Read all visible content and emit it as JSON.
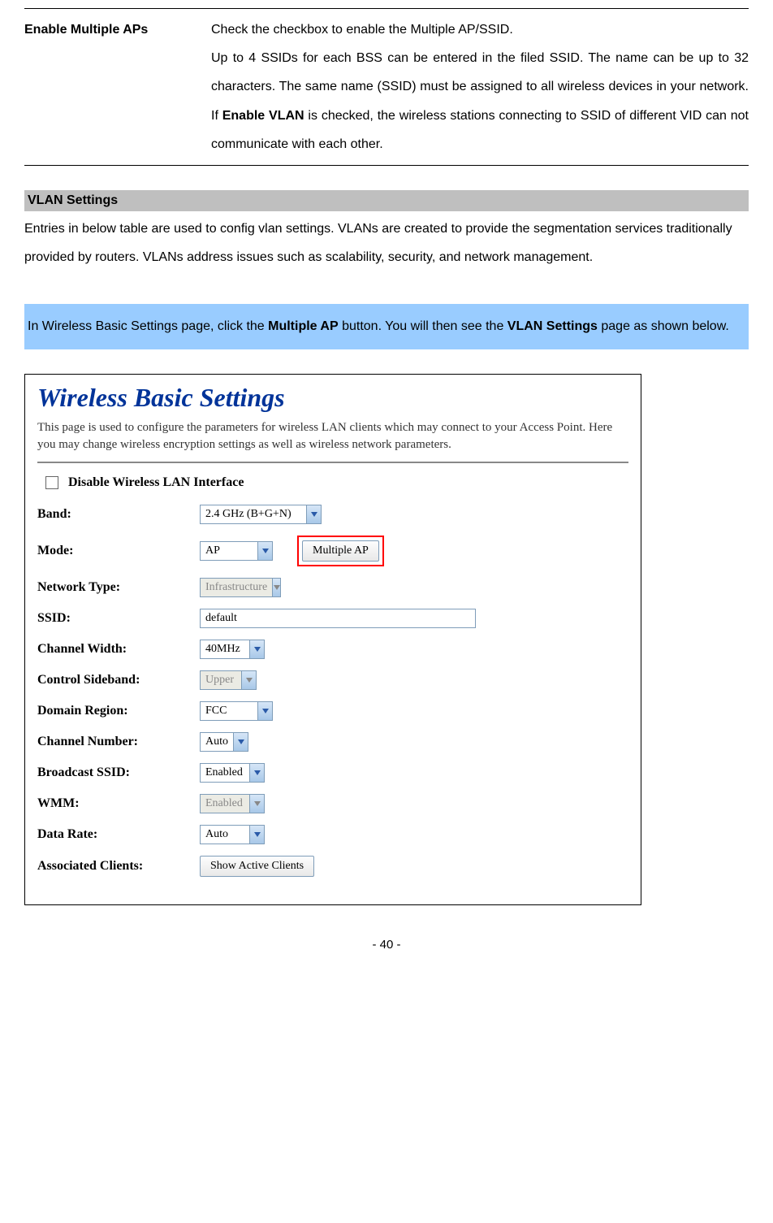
{
  "definition": {
    "term": "Enable Multiple APs",
    "description_parts": {
      "line1": "Check the checkbox to enable the Multiple AP/SSID.",
      "line2_pre": "Up to 4 SSIDs for each BSS can be entered in the filed SSID. The name can be up to 32 characters. The same name (SSID) must be assigned to all wireless devices in your network. If ",
      "bold": "Enable VLAN",
      "line2_post": " is checked, the wireless stations connecting to SSID of different VID can not communicate with each other."
    }
  },
  "vlan": {
    "header": "VLAN Settings",
    "intro": "Entries in below table are used to config vlan settings. VLANs are created to provide the segmentation services traditionally provided by routers. VLANs address issues such as scalability, security, and network management."
  },
  "infobox": {
    "pre": "In Wireless Basic Settings page, click the ",
    "bold1": "Multiple AP",
    "mid": " button. You will then see the ",
    "bold2": "VLAN Settings",
    "post": " page as shown below."
  },
  "screenshot": {
    "title": "Wireless Basic Settings",
    "description": "This page is used to configure the parameters for wireless LAN clients which may connect to your Access Point. Here you may change wireless encryption settings as well as wireless network parameters.",
    "disable_label": "Disable Wireless LAN Interface",
    "fields": {
      "band": {
        "label": "Band:",
        "value": "2.4 GHz (B+G+N)"
      },
      "mode": {
        "label": "Mode:",
        "value": "AP",
        "button": "Multiple AP"
      },
      "network_type": {
        "label": "Network Type:",
        "value": "Infrastructure"
      },
      "ssid": {
        "label": "SSID:",
        "value": "default"
      },
      "channel_width": {
        "label": "Channel Width:",
        "value": "40MHz"
      },
      "control_sideband": {
        "label": "Control Sideband:",
        "value": "Upper"
      },
      "domain_region": {
        "label": "Domain Region:",
        "value": "FCC"
      },
      "channel_number": {
        "label": "Channel Number:",
        "value": "Auto"
      },
      "broadcast_ssid": {
        "label": "Broadcast SSID:",
        "value": "Enabled"
      },
      "wmm": {
        "label": "WMM:",
        "value": "Enabled"
      },
      "data_rate": {
        "label": "Data Rate:",
        "value": "Auto"
      },
      "associated_clients": {
        "label": "Associated Clients:",
        "button": "Show Active Clients"
      }
    }
  },
  "footer": "- 40 -"
}
